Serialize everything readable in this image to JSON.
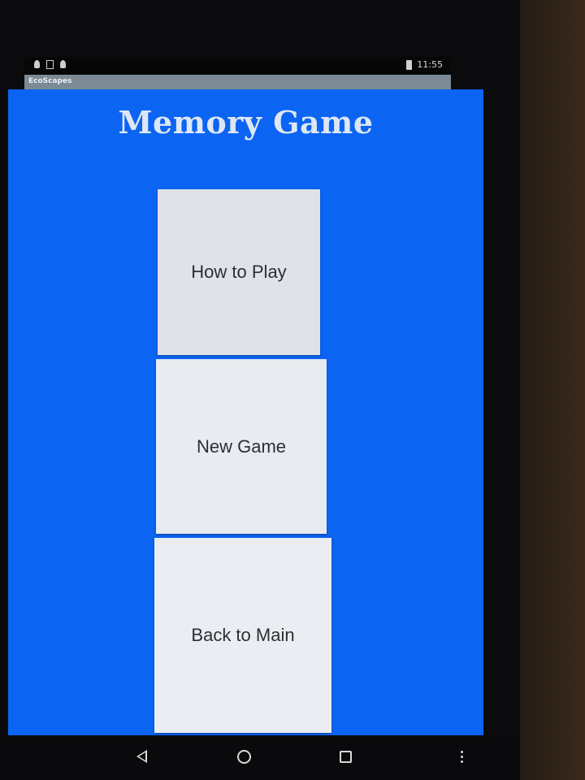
{
  "status_bar": {
    "time": "11:55",
    "icons": [
      "location-pin-icon",
      "sim-card-icon",
      "location-pin-icon",
      "battery-icon"
    ]
  },
  "action_bar": {
    "app_title": "EcoScapes"
  },
  "main": {
    "title": "Memory Game",
    "buttons": [
      {
        "label": "How to Play"
      },
      {
        "label": "New Game"
      },
      {
        "label": "Back to Main"
      }
    ]
  },
  "nav_bar": {
    "icons": [
      "back-icon",
      "home-icon",
      "recents-icon",
      "overflow-menu-icon"
    ]
  },
  "colors": {
    "screen_background": "#0b64f2",
    "button_background": "#e6e9ee",
    "title_text": "#dde7f5"
  }
}
